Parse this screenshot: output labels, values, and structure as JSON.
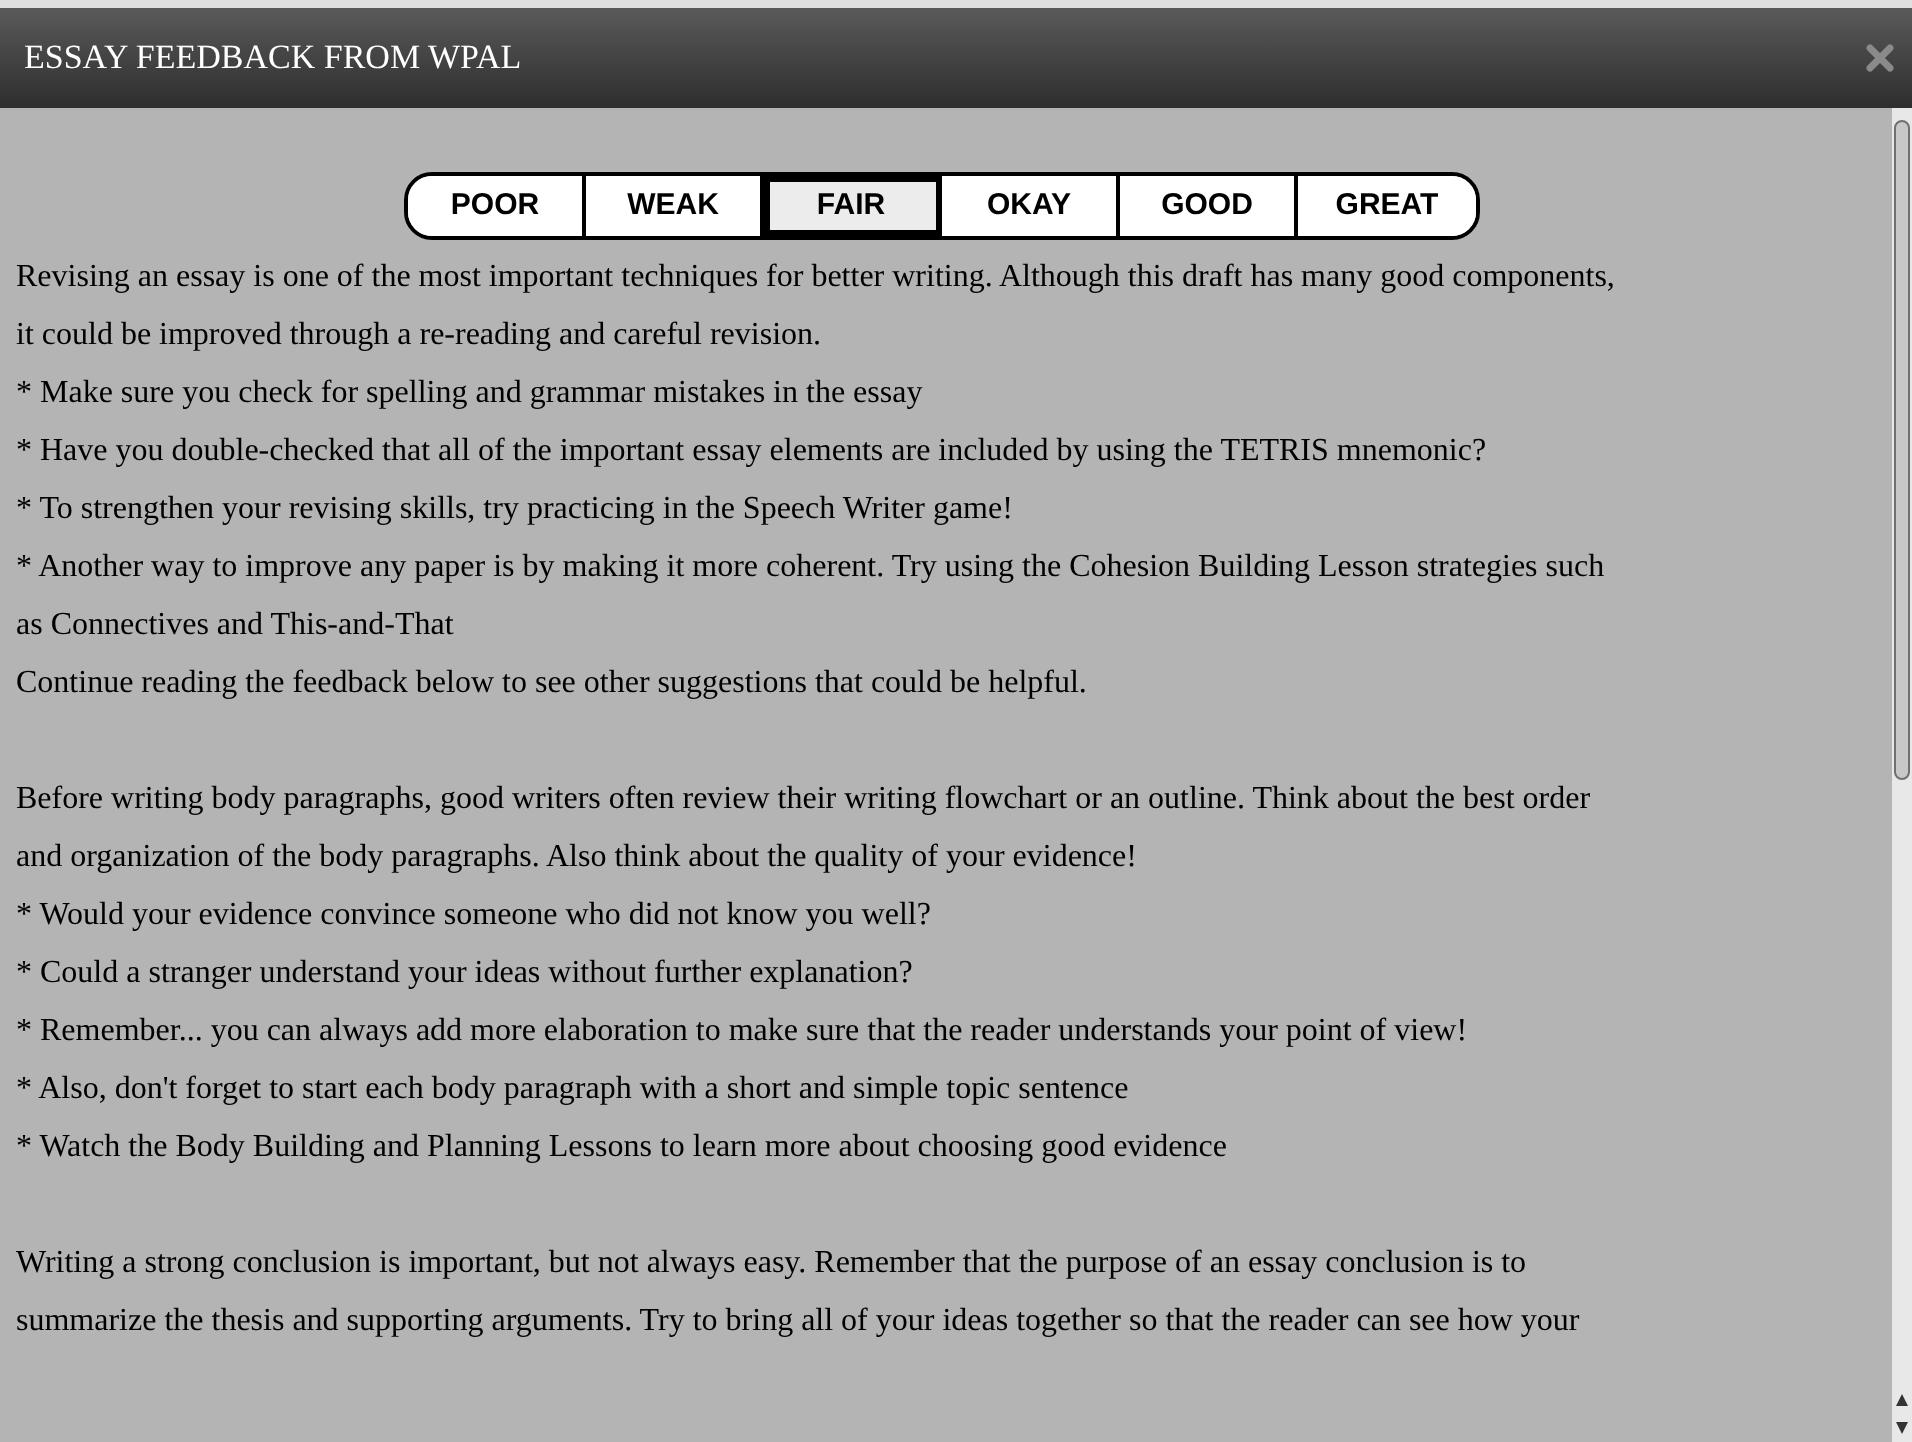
{
  "window": {
    "title": "ESSAY FEEDBACK FROM WPAL"
  },
  "rating": [
    {
      "label": "POOR",
      "selected": false
    },
    {
      "label": "WEAK",
      "selected": false
    },
    {
      "label": "FAIR",
      "selected": true
    },
    {
      "label": "OKAY",
      "selected": false
    },
    {
      "label": "GOOD",
      "selected": false
    },
    {
      "label": "GREAT",
      "selected": false
    }
  ],
  "feedback": [
    {
      "lines": [
        "Revising an essay is one of the most important techniques for better writing. Although this draft has many good components,",
        "it could be improved through a re-reading and careful revision.",
        "* Make sure you check for spelling and grammar mistakes in the essay",
        "* Have you double-checked that all of the important essay elements are included by using the TETRIS mnemonic?",
        "* To strengthen your revising skills, try practicing in the Speech Writer game!",
        "* Another way to improve any paper is by making it more coherent. Try using the Cohesion Building Lesson strategies such",
        "as Connectives and This-and-That",
        "Continue reading the feedback below to see other suggestions that could be helpful."
      ]
    },
    {
      "lines": [
        "Before writing body paragraphs, good writers often review their writing flowchart or an outline. Think about the best order",
        "and organization of the body paragraphs. Also think about the quality of your evidence!",
        "* Would your evidence convince someone who did not know you well?",
        "* Could a stranger understand your ideas without further explanation?",
        "* Remember... you can always add more elaboration to make sure that the reader understands your point of view!",
        "* Also, don't forget to start each body paragraph with a short and simple topic sentence",
        "* Watch the Body Building and Planning Lessons to learn more about choosing good evidence"
      ]
    },
    {
      "lines": [
        "Writing a strong conclusion is important, but not always easy. Remember that the purpose of an essay conclusion is to",
        "summarize the thesis and supporting arguments. Try to bring all of your ideas together so that the reader can see how your"
      ]
    }
  ]
}
